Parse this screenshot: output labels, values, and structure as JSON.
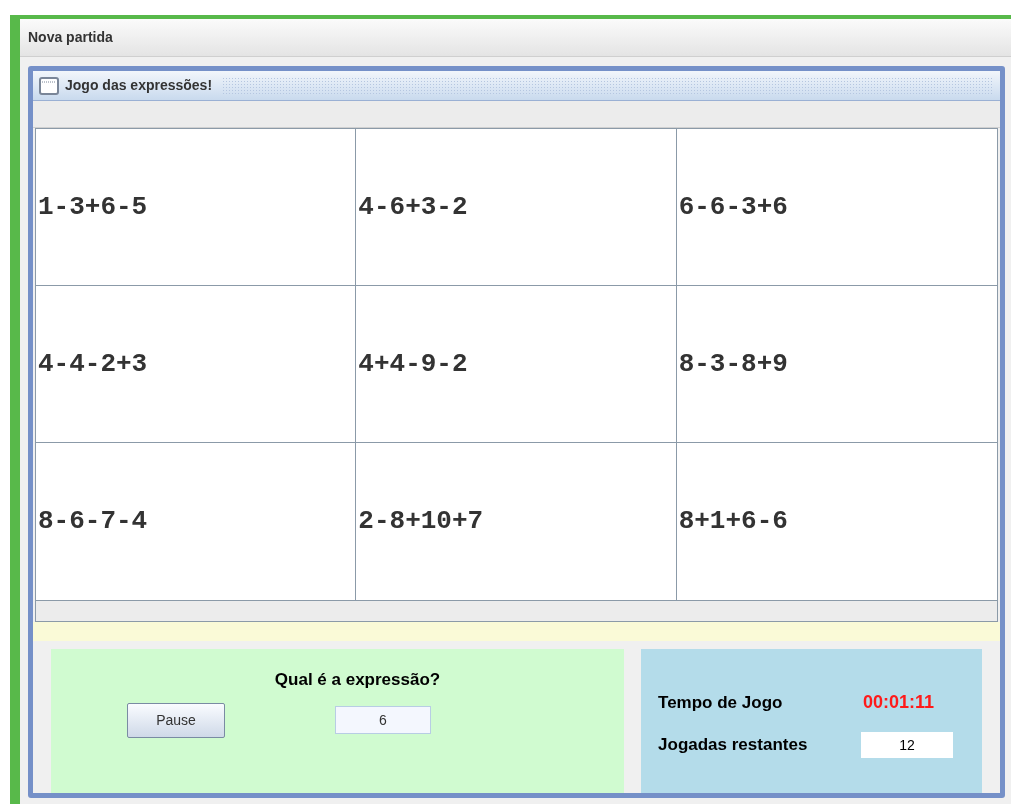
{
  "window": {
    "title": "Nova partida"
  },
  "internal_frame": {
    "title": "Jogo das expressões!"
  },
  "grid": [
    [
      "1-3+6-5",
      "4-6+3-2",
      "6-6-3+6"
    ],
    [
      "4-4-2+3",
      "4+4-9-2",
      "8-3-8+9"
    ],
    [
      "8-6-7-4",
      "2-8+10+7",
      "8+1+6-6"
    ]
  ],
  "question": {
    "label": "Qual é a expressão?",
    "pause_button": "Pause",
    "answer_value": "6"
  },
  "status": {
    "time_label": "Tempo de Jogo",
    "time_value": "00:01:11",
    "moves_label": "Jogadas restantes",
    "moves_value": "12"
  }
}
